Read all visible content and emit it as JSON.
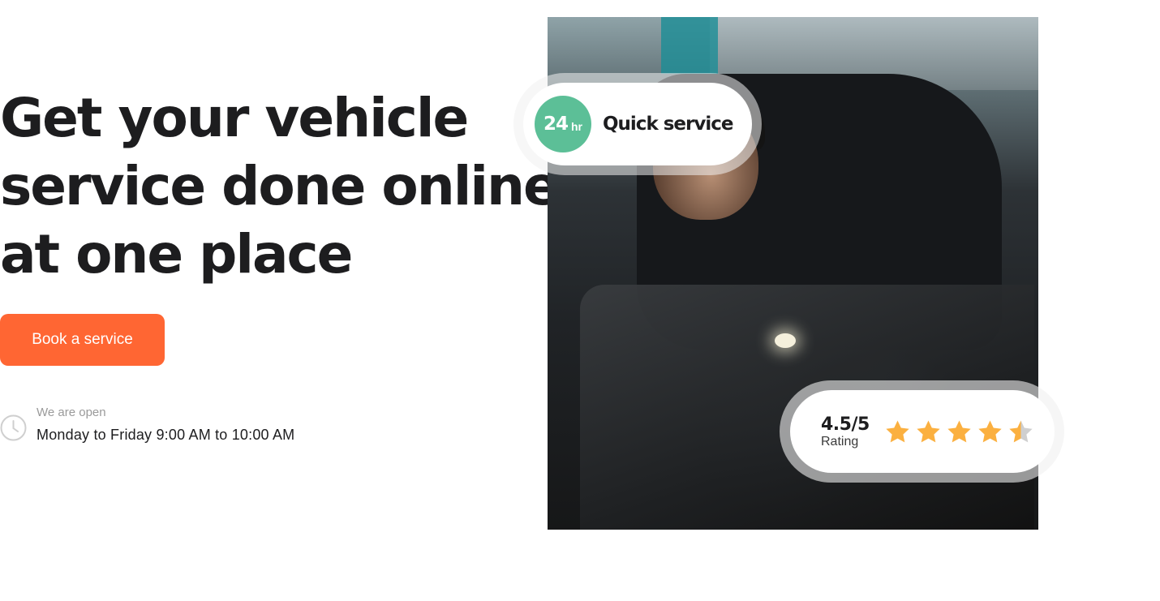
{
  "hero": {
    "title_lines": [
      "Get your vehicle",
      "service done online",
      "at one place"
    ],
    "cta_label": "Book a service"
  },
  "hours": {
    "label": "We are open",
    "value": "Monday to Friday 9:00 AM to  10:00  AM",
    "icon": "clock-icon"
  },
  "quick_badge": {
    "number": "24",
    "unit": "hr",
    "label": "Quick service",
    "color": "#5cbf97"
  },
  "rating_badge": {
    "value": "4.5/5",
    "label": "Rating",
    "stars_total": 5,
    "stars_filled": 4.5,
    "star_color": "#fbb040",
    "star_empty_color": "#cfcfcf"
  },
  "colors": {
    "accent": "#ff6633",
    "text": "#1d1d1f",
    "muted": "#9a9a9a"
  },
  "image": {
    "subject": "mechanic-working-on-engine"
  }
}
